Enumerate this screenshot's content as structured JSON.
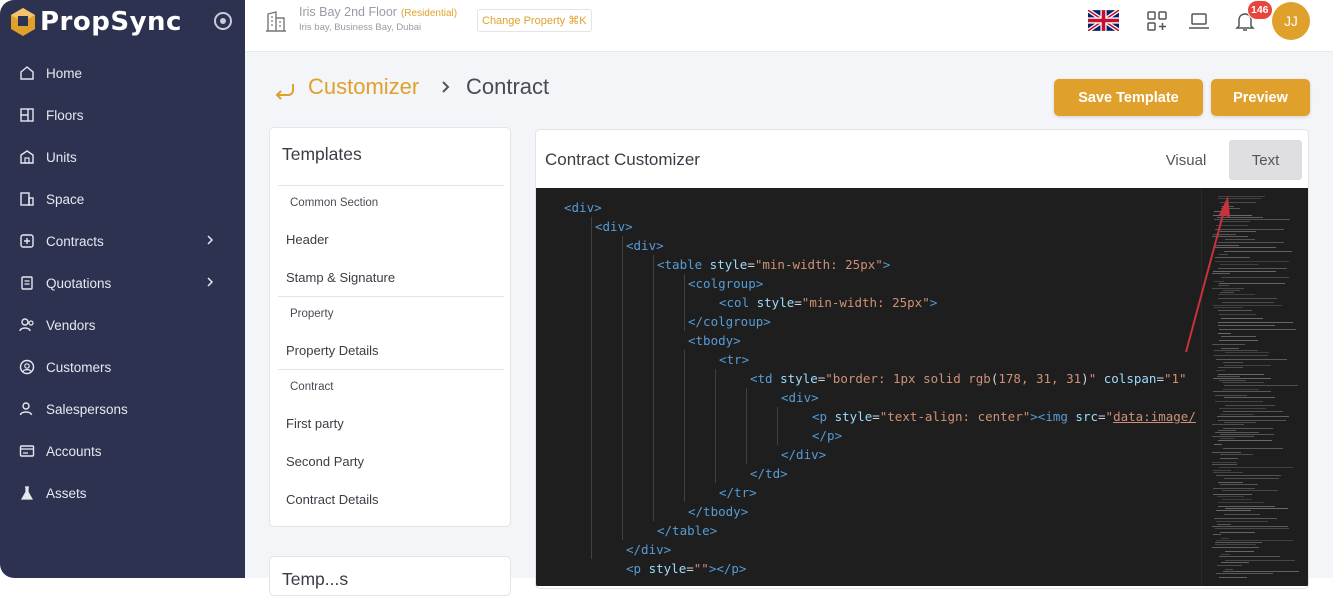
{
  "app": {
    "name": "PropSync"
  },
  "sidebar": {
    "items": [
      {
        "label": "Home",
        "icon": "home-icon"
      },
      {
        "label": "Floors",
        "icon": "floors-icon"
      },
      {
        "label": "Units",
        "icon": "units-icon"
      },
      {
        "label": "Space",
        "icon": "space-icon"
      },
      {
        "label": "Contracts",
        "icon": "contracts-icon",
        "has_children": true
      },
      {
        "label": "Quotations",
        "icon": "quotations-icon",
        "has_children": true
      },
      {
        "label": "Vendors",
        "icon": "vendors-icon"
      },
      {
        "label": "Customers",
        "icon": "customers-icon"
      },
      {
        "label": "Salespersons",
        "icon": "salespersons-icon"
      },
      {
        "label": "Accounts",
        "icon": "accounts-icon"
      },
      {
        "label": "Assets",
        "icon": "assets-icon"
      }
    ]
  },
  "topbar": {
    "property_name": "Iris Bay 2nd Floor",
    "property_type": "(Residential)",
    "property_address": "Iris bay, Business Bay, Dubai",
    "change_property_label": "Change Property ⌘K",
    "notification_count": "146",
    "avatar_initials": "JJ"
  },
  "breadcrumb": {
    "parent": "Customizer",
    "current": "Contract"
  },
  "actions": {
    "save_template": "Save Template",
    "preview": "Preview"
  },
  "templates": {
    "title": "Templates",
    "sections": [
      {
        "heading": "Common Section",
        "items": [
          "Header",
          "Stamp & Signature"
        ]
      },
      {
        "heading": "Property",
        "items": [
          "Property Details"
        ]
      },
      {
        "heading": "Contract",
        "items": [
          "First party",
          "Second Party",
          "Contract Details"
        ]
      }
    ],
    "next_panel_title": "Temp...s"
  },
  "editor": {
    "title": "Contract Customizer",
    "tabs": {
      "visual": "Visual",
      "text": "Text",
      "active": "Text"
    },
    "code_lines": [
      "<div>",
      "<div>",
      "<div>",
      "<table style=\"min-width: 25px\">",
      "<colgroup>",
      "<col style=\"min-width: 25px\">",
      "</colgroup>",
      "<tbody>",
      "<tr>",
      "<td style=\"border: 1px solid rgb(178, 31, 31)\" colspan=\"1\"",
      "<div>",
      "<p style=\"text-align: center\"><img src=\"data:image/",
      "</p>",
      "</div>",
      "</td>",
      "</tr>",
      "</tbody>",
      "</table>",
      "</div>",
      "<p style=\"\"></p>"
    ]
  },
  "colors": {
    "accent": "#e0a12c",
    "sidebar_bg": "#2d3250",
    "annotation_arrow": "#c8323a"
  }
}
